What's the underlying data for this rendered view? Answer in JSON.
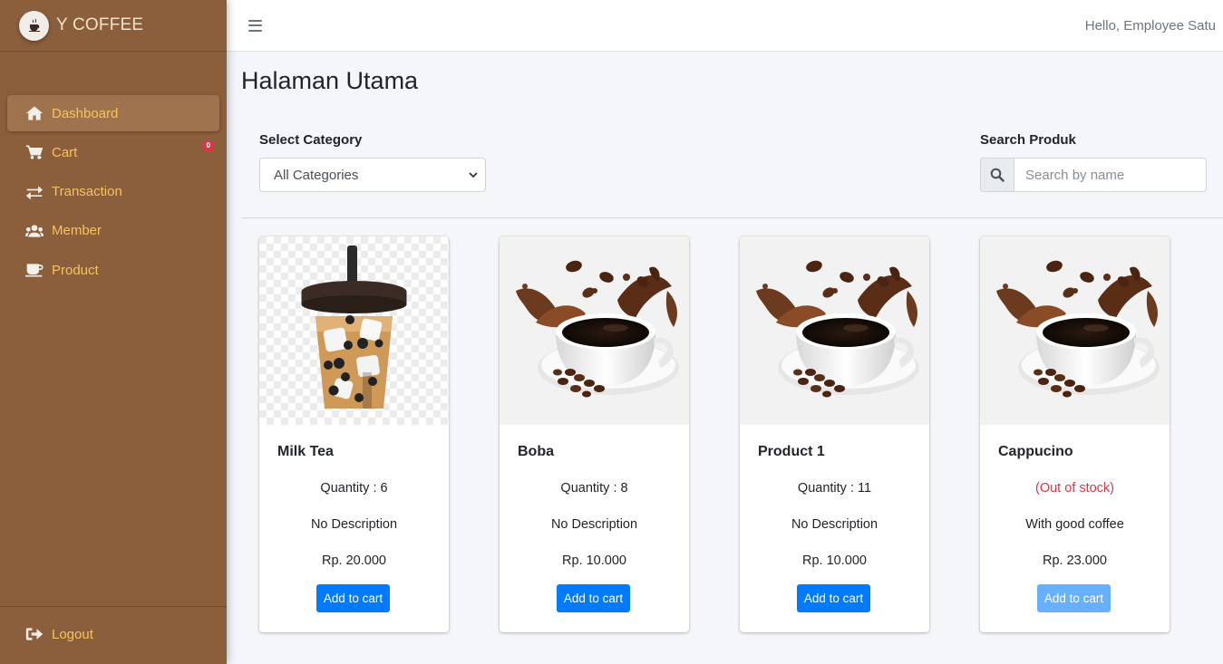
{
  "app": {
    "brand": "Y COFFEE"
  },
  "sidebar": {
    "items": [
      {
        "label": "Dashboard",
        "icon": "home-icon",
        "active": true
      },
      {
        "label": "Cart",
        "icon": "cart-icon",
        "badge": "0"
      },
      {
        "label": "Transaction",
        "icon": "exchange-icon"
      },
      {
        "label": "Member",
        "icon": "users-icon"
      },
      {
        "label": "Product",
        "icon": "mug-icon"
      }
    ],
    "logout": {
      "label": "Logout",
      "icon": "sign-out-icon"
    }
  },
  "header": {
    "greeting": "Hello, Employee Satu"
  },
  "main": {
    "title": "Halaman Utama",
    "category": {
      "label": "Select Category",
      "selected": "All Categories"
    },
    "search": {
      "label": "Search Produk",
      "placeholder": "Search by name"
    }
  },
  "products": [
    {
      "name": "Milk Tea",
      "stock": "Quantity : 6",
      "description": "No Description",
      "price": "Rp. 20.000",
      "button": "Add to cart",
      "image": "milk-tea"
    },
    {
      "name": "Boba",
      "stock": "Quantity : 8",
      "description": "No Description",
      "price": "Rp. 10.000",
      "button": "Add to cart",
      "image": "coffee-cup"
    },
    {
      "name": "Product 1",
      "stock": "Quantity : 11",
      "description": "No Description",
      "price": "Rp. 10.000",
      "button": "Add to cart",
      "image": "coffee-cup"
    },
    {
      "name": "Cappucino",
      "stock": "(Out of stock)",
      "description": "With good coffee",
      "price": "Rp. 23.000",
      "button": "Add to cart",
      "image": "coffee-cup",
      "out_of_stock": true
    }
  ],
  "colors": {
    "sidebar": "#8b5e3c",
    "nav_text": "#f8c35d",
    "primary": "#007bff",
    "danger": "#dc3545"
  }
}
